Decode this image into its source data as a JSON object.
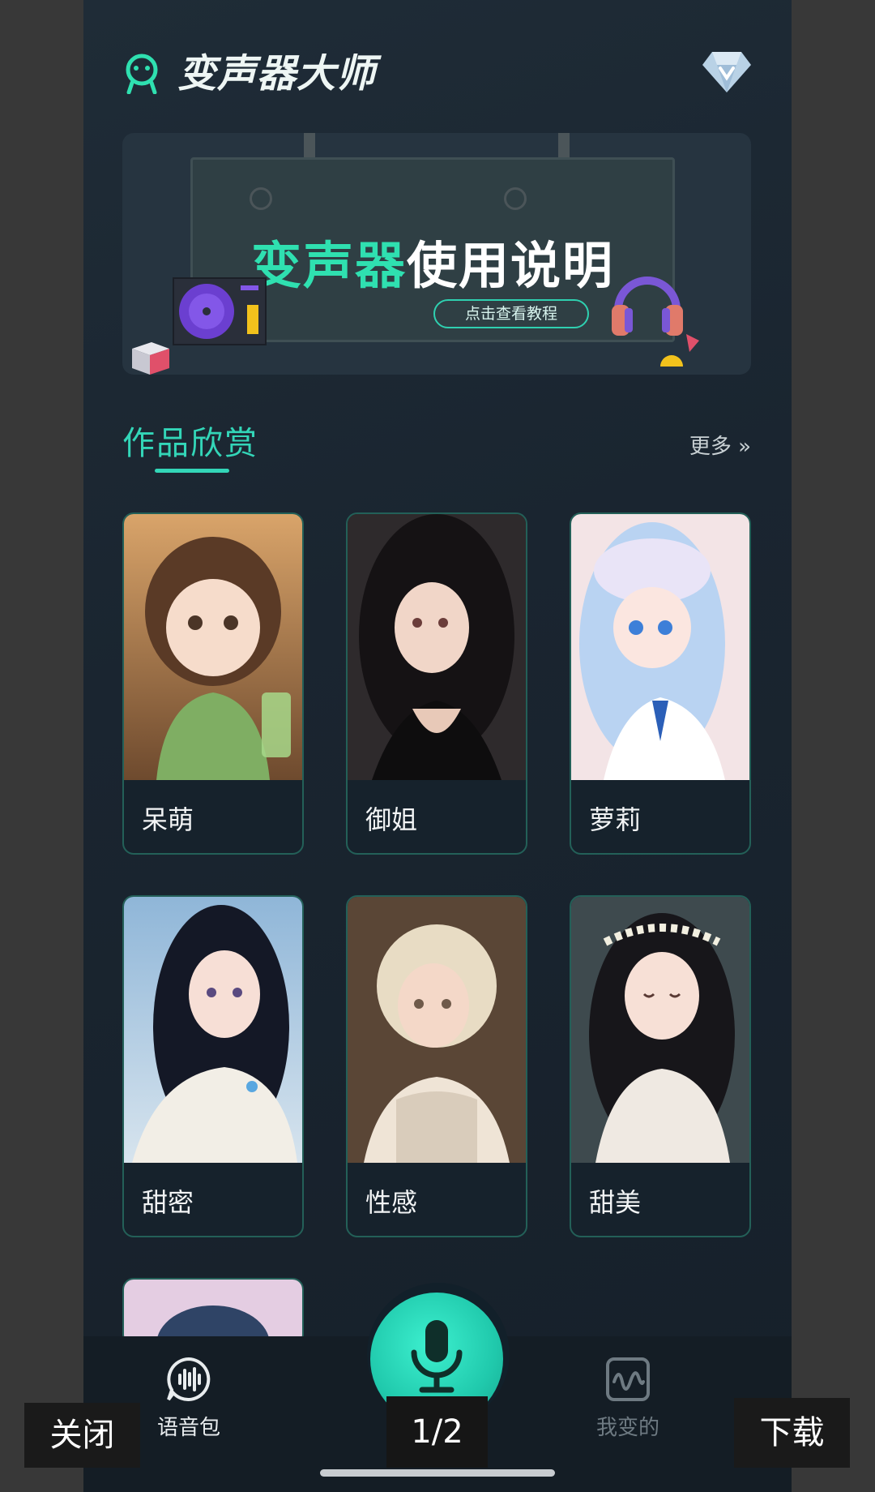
{
  "header": {
    "title": "变声器大师",
    "logo_icon": "robot-face-icon",
    "vip_icon": "diamond-icon"
  },
  "banner": {
    "title_part1": "变声器",
    "title_part2": "使用说明",
    "button_label": "点击查看教程"
  },
  "section": {
    "title": "作品欣赏",
    "more_label": "更多 »"
  },
  "cards": [
    {
      "label": "呆萌"
    },
    {
      "label": "御姐"
    },
    {
      "label": "萝莉"
    },
    {
      "label": "甜密"
    },
    {
      "label": "性感"
    },
    {
      "label": "甜美"
    }
  ],
  "nav": {
    "voice_pack": "语音包",
    "mine": "我变的",
    "center_icon": "microphone-icon"
  },
  "overlay": {
    "close": "关闭",
    "page_indicator": "1/2",
    "download": "下载"
  },
  "colors": {
    "accent": "#33d6b8",
    "background": "#1a2530",
    "card_border": "#236058"
  }
}
